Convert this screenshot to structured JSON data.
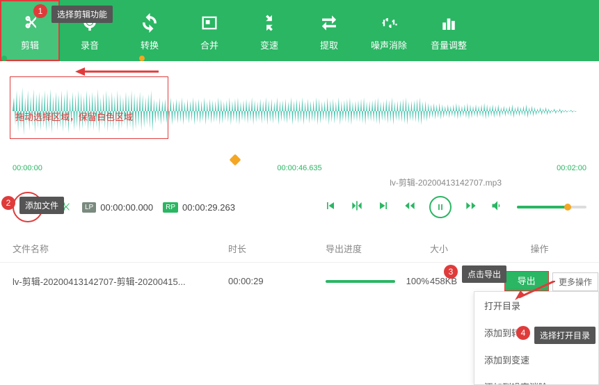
{
  "toolbar": {
    "items": [
      {
        "label": "剪辑",
        "icon": "cut"
      },
      {
        "label": "录音",
        "icon": "mic"
      },
      {
        "label": "转换",
        "icon": "convert"
      },
      {
        "label": "合并",
        "icon": "merge"
      },
      {
        "label": "变速",
        "icon": "speed"
      },
      {
        "label": "提取",
        "icon": "extract"
      },
      {
        "label": "噪声消除",
        "icon": "noise"
      },
      {
        "label": "音量调整",
        "icon": "volume"
      }
    ]
  },
  "annotations": {
    "badge1": "1",
    "tip1": "选择剪辑功能",
    "badge2": "2",
    "tip2": "添加文件",
    "badge3": "3",
    "tip3": "点击导出",
    "badge4": "4",
    "tip4": "选择打开目录",
    "selection_hint": "拖动选择区域，保留白色区域"
  },
  "timeline": {
    "start": "00:00:00",
    "mid": "00:00:46.635",
    "end": "00:02:00"
  },
  "controls": {
    "lp_label": "LP",
    "lp_time": "00:00:00.000",
    "rp_label": "RP",
    "rp_time": "00:00:29.263",
    "current_file": "lv-剪辑-20200413142707.mp3"
  },
  "table": {
    "headers": {
      "name": "文件名称",
      "duration": "时长",
      "progress": "导出进度",
      "size": "大小",
      "action": "操作"
    },
    "rows": [
      {
        "name": "lv-剪辑-20200413142707-剪辑-20200415...",
        "duration": "00:00:29",
        "progress_pct": "100%",
        "size": "458KB",
        "export_label": "导出"
      }
    ]
  },
  "dropdown": {
    "more_ops": "更多操作",
    "items": [
      "打开目录",
      "添加到转换",
      "添加到变速",
      "添加到噪声消除"
    ]
  }
}
